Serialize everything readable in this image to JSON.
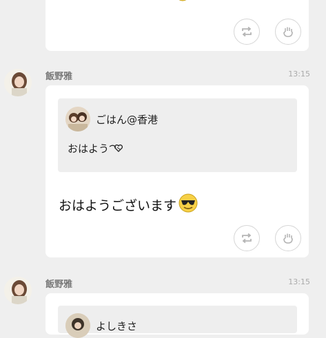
{
  "messages": [
    {
      "id": "top-partial",
      "text_visible": "…"
    },
    {
      "id": "msg-1",
      "sender": "飯野雅",
      "time": "13:15",
      "quote": {
        "author": "ごはん@香港",
        "text": "おはよう"
      },
      "text": "おはようございます"
    },
    {
      "id": "msg-2",
      "sender": "飯野雅",
      "time": "13:15",
      "quote": {
        "author": "よしきさ"
      }
    }
  ],
  "icons": {
    "retweet": "retweet-icon",
    "like": "hand-icon",
    "heart": "heart-emoji",
    "sunglasses": "sunglasses-emoji"
  },
  "colors": {
    "background": "#efefef",
    "card": "#ffffff",
    "quote": "#eeeeee",
    "meta": "#aaaaaa"
  }
}
